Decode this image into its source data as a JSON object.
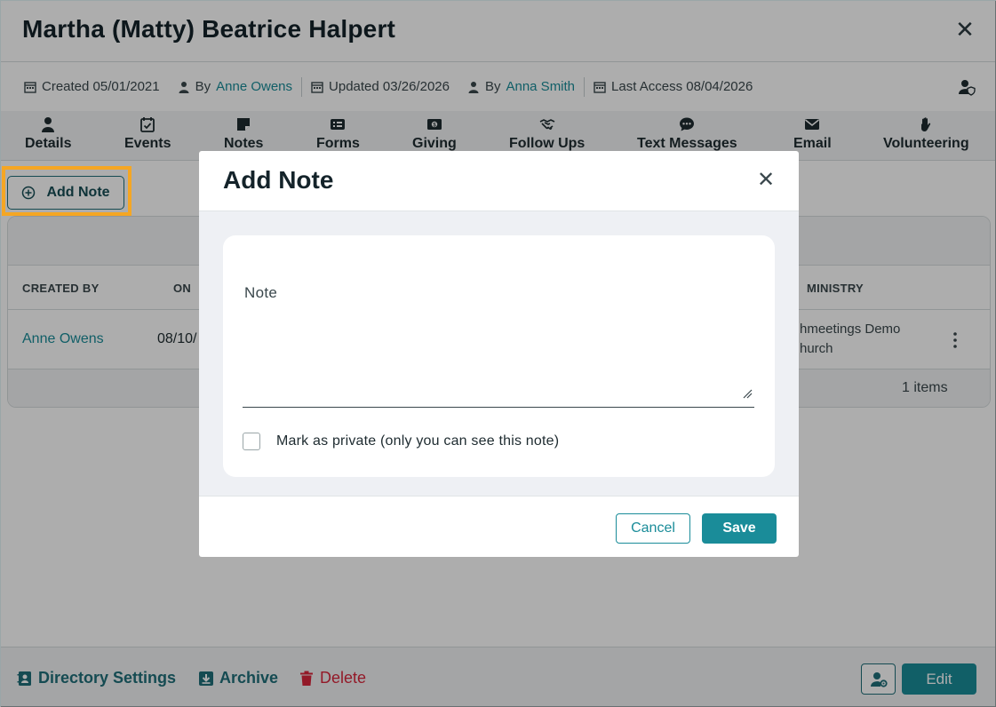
{
  "person": {
    "name": "Martha (Matty) Beatrice Halpert"
  },
  "meta": {
    "created": "Created 05/01/2021",
    "created_by_prefix": "By",
    "created_by": "Anne Owens",
    "updated": "Updated 03/26/2026",
    "updated_by_prefix": "By",
    "updated_by": "Anna Smith",
    "last_access": "Last Access 08/04/2026"
  },
  "tabs": [
    {
      "label": "Details",
      "icon": "person-icon"
    },
    {
      "label": "Events",
      "icon": "calendar-check-icon"
    },
    {
      "label": "Notes",
      "icon": "sticky-note-icon"
    },
    {
      "label": "Forms",
      "icon": "form-icon"
    },
    {
      "label": "Giving",
      "icon": "money-icon"
    },
    {
      "label": "Follow Ups",
      "icon": "handshake-icon"
    },
    {
      "label": "Text Messages",
      "icon": "chat-bubble-icon"
    },
    {
      "label": "Email",
      "icon": "envelope-icon"
    },
    {
      "label": "Volunteering",
      "icon": "hand-icon"
    }
  ],
  "toolbar": {
    "add_note_label": "Add Note"
  },
  "table": {
    "columns": [
      "CREATED BY",
      "ON",
      "MINISTRY"
    ],
    "rows": [
      {
        "created_by": "Anne Owens",
        "on": "08/10/",
        "ministry_line1": "hmeetings Demo",
        "ministry_line2": "hurch"
      }
    ],
    "footer_count": "1 items"
  },
  "footer": {
    "directory_settings": "Directory Settings",
    "archive": "Archive",
    "delete": "Delete",
    "edit": "Edit"
  },
  "modal": {
    "title": "Add Note",
    "note_label": "Note",
    "note_value": "",
    "private_label": "Mark as private (only you can see this note)",
    "cancel": "Cancel",
    "save": "Save"
  },
  "colors": {
    "accent": "#1a8c99",
    "danger": "#d9263b",
    "highlight": "#f5a623",
    "title": "#14232a"
  }
}
